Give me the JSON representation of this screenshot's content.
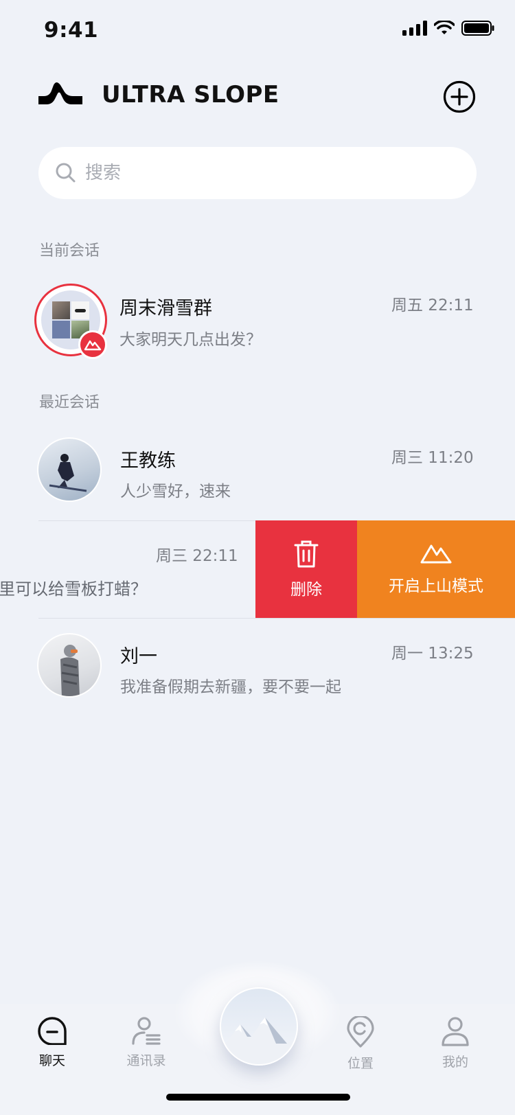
{
  "status": {
    "time": "9:41"
  },
  "header": {
    "title": "ULTRA SLOPE"
  },
  "search": {
    "placeholder": "搜索"
  },
  "sections": {
    "current": "当前会话",
    "recent": "最近会话"
  },
  "current_chats": [
    {
      "name": "周末滑雪群",
      "message": "大家明天几点出发？",
      "time": "周五 22:11"
    }
  ],
  "recent_chats": [
    {
      "name": "王教练",
      "message": "人少雪好，速来",
      "time": "周三 11:20"
    },
    {
      "name": "",
      "message": "里可以给雪板打蜡？",
      "time": "周三 22:11"
    },
    {
      "name": "刘一",
      "message": "我准备假期去新疆，要不要一起",
      "time": "周一 13:25"
    }
  ],
  "swipe_actions": {
    "delete": "删除",
    "mountain_mode": "开启上山模式"
  },
  "tabs": [
    {
      "label": "聊天",
      "icon": "chat-icon",
      "active": true
    },
    {
      "label": "通讯录",
      "icon": "contacts-icon",
      "active": false
    },
    {
      "label": "位置",
      "icon": "location-icon",
      "active": false
    },
    {
      "label": "我的",
      "icon": "profile-icon",
      "active": false
    }
  ],
  "colors": {
    "delete": "#e8323f",
    "mountain_mode": "#f0831f",
    "background": "#eff2f8"
  }
}
